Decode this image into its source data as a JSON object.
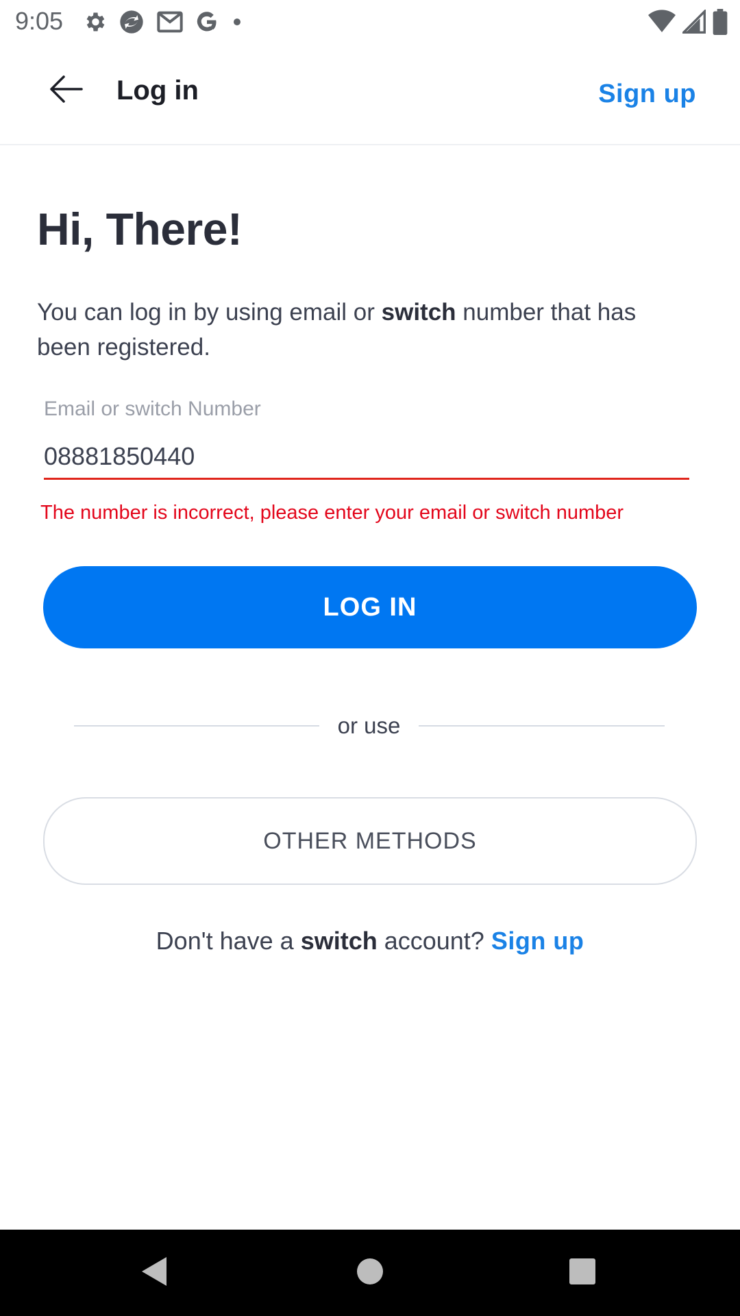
{
  "status_bar": {
    "time": "9:05",
    "left_icons": [
      "gear-icon",
      "sync-app-icon",
      "gmail-icon",
      "google-icon",
      "dot-icon"
    ],
    "right_icons": [
      "wifi-icon",
      "cell-signal-icon",
      "battery-icon"
    ]
  },
  "app_bar": {
    "title": "Log in",
    "signup_label": "Sign up",
    "back_icon": "arrow-left-icon"
  },
  "content": {
    "greeting": "Hi, There!",
    "intro_prefix": "You can log in by using email or ",
    "intro_brand": "switch",
    "intro_suffix": " number that has been registered.",
    "field": {
      "label": "Email or switch Number",
      "value": "08881850440",
      "error": "The number is incorrect, please enter your email or switch number"
    },
    "login_label": "LOG IN",
    "divider_text": "or use",
    "other_methods_label": "OTHER METHODS",
    "footer_prefix": "Don't have a ",
    "footer_brand": "switch",
    "footer_middle": " account? ",
    "footer_signup": "Sign up"
  },
  "colors": {
    "primary": "#0077f2",
    "link": "#1a82e6",
    "error": "#e3061b",
    "text_dark": "#2b2e3a"
  },
  "nav_bar": {
    "icons": [
      "nav-back-icon",
      "nav-home-icon",
      "nav-recents-icon"
    ]
  }
}
